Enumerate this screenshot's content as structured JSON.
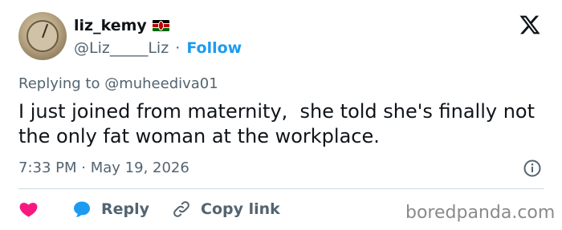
{
  "author": {
    "display_name": "liz_kemy",
    "handle": "@Liz_____Liz",
    "separator": "·",
    "follow_label": "Follow"
  },
  "reply_context": "Replying to @muheediva01",
  "tweet": {
    "text": "I just joined from maternity,  she told she's finally not the only fat woman at the workplace.",
    "time": "7:33 PM",
    "separator": "·",
    "date": "May 19, 2026"
  },
  "actions": {
    "reply_label": "Reply",
    "copy_link_label": "Copy link"
  },
  "watermark": "boredpanda.com",
  "icons": {
    "avatar": "avatar",
    "flag": "kenya-flag-icon",
    "logo": "x-logo-icon",
    "info": "info-icon",
    "like": "heart-icon",
    "reply": "reply-bubble-icon",
    "copy": "link-icon"
  },
  "colors": {
    "text": "#0f1419",
    "secondary": "#536471",
    "accent": "#1d9bf0",
    "heart": "#f91880",
    "divider": "#cfd9de"
  }
}
